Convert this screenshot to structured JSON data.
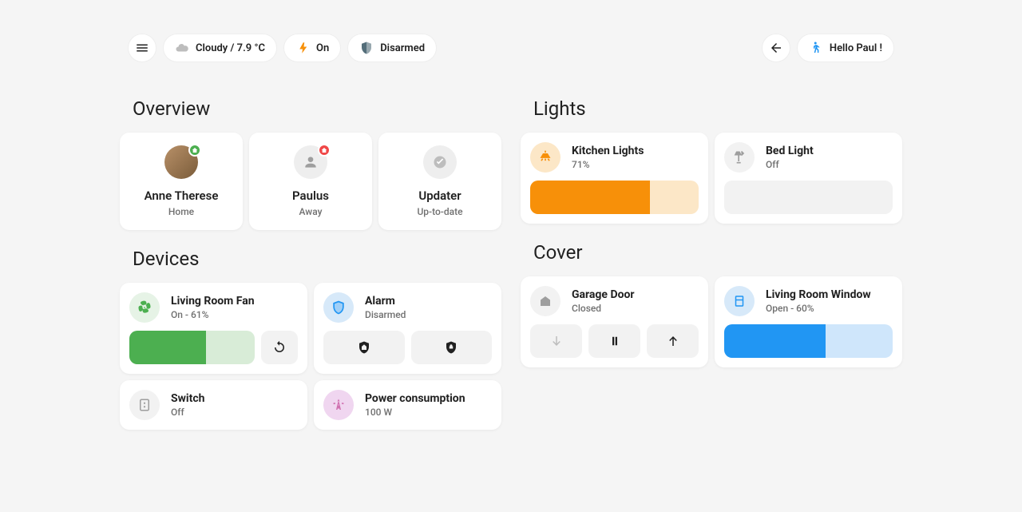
{
  "topbar": {
    "left": [
      {
        "icon": "menu",
        "label": null
      },
      {
        "icon": "cloudy",
        "label": "Cloudy / 7.9 °C"
      },
      {
        "icon": "flash-on",
        "label": "On"
      },
      {
        "icon": "shield-half",
        "label": "Disarmed"
      }
    ],
    "right": [
      {
        "icon": "arrow-left",
        "label": null
      },
      {
        "icon": "walk",
        "label": "Hello Paul !"
      }
    ]
  },
  "overview": {
    "title": "Overview",
    "items": [
      {
        "name": "Anne Therese",
        "state": "Home",
        "badge": "green",
        "avatar": "photo"
      },
      {
        "name": "Paulus",
        "state": "Away",
        "badge": "red",
        "avatar": "person"
      },
      {
        "name": "Updater",
        "state": "Up-to-date",
        "badge": null,
        "avatar": "check"
      }
    ]
  },
  "lights": {
    "title": "Lights",
    "items": [
      {
        "name": "Kitchen Lights",
        "state": "71%",
        "on": true,
        "percent": 71,
        "color": "#f79009",
        "icon": "ceiling-light"
      },
      {
        "name": "Bed Light",
        "state": "Off",
        "on": false,
        "percent": 0,
        "color": "#9e9e9e",
        "icon": "floor-lamp"
      }
    ]
  },
  "devices": {
    "title": "Devices",
    "fan": {
      "name": "Living Room Fan",
      "state": "On - 61%",
      "percent": 61,
      "color": "#4caf50",
      "icon": "fan"
    },
    "alarm": {
      "name": "Alarm",
      "state": "Disarmed",
      "color": "#2196f3",
      "icon": "shield-off"
    },
    "switch": {
      "name": "Switch",
      "state": "Off",
      "icon": "power-socket"
    },
    "power": {
      "name": "Power consumption",
      "state": "100 W",
      "icon": "transmission-tower"
    }
  },
  "cover": {
    "title": "Cover",
    "garage": {
      "name": "Garage Door",
      "state": "Closed",
      "icon": "garage"
    },
    "window": {
      "name": "Living Room Window",
      "state": "Open - 60%",
      "percent": 60,
      "color": "#2196f3",
      "icon": "window-open"
    }
  },
  "colors": {
    "orange": "#f79009",
    "orange_faint": "#fce7c7",
    "green": "#4caf50",
    "green_faint": "#d8ecd7",
    "blue": "#2196f3",
    "blue_faint": "#cfe6fb",
    "grey": "#f2f2f2",
    "grey_icon": "#757575",
    "pink": "#f0d6f0",
    "pink_icon": "#d070b0"
  }
}
